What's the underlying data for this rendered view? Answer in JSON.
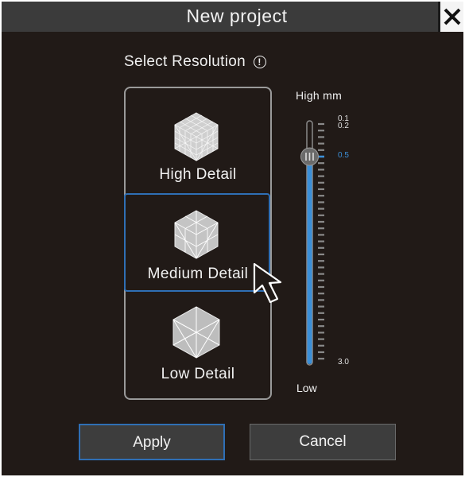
{
  "dialog": {
    "title": "New project",
    "close_icon": "close-icon"
  },
  "resolution": {
    "heading": "Select Resolution",
    "info_icon": "info-icon",
    "info_glyph": "!",
    "options": [
      {
        "label": "High Detail",
        "icon": "high-detail-cube-icon"
      },
      {
        "label": "Medium Detail",
        "icon": "medium-detail-cube-icon",
        "selected": true
      },
      {
        "label": "Low Detail",
        "icon": "low-detail-cube-icon"
      }
    ]
  },
  "slider": {
    "top_label": "High mm",
    "bottom_label": "Low",
    "tick_labels_top": [
      "0.1",
      "0.2"
    ],
    "selected_value": "0.5",
    "tick_label_bottom": "3.0",
    "accent_color": "#3a8fd8"
  },
  "buttons": {
    "apply": "Apply",
    "cancel": "Cancel"
  }
}
